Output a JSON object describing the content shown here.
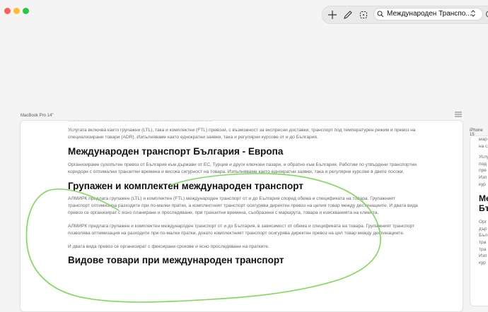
{
  "toolbar": {
    "search_value": "Международен Транспо..."
  },
  "devices": {
    "main_label": "MacBook Pro 14\"",
    "side_label": "iPhone 15"
  },
  "page": {
    "top_text": "................................................................................................................",
    "p1": "Услугата включва както групажни (LTL), така и комплектни (FTL) превози, с възможност за експресни доставки, транспорт под температурен режим и превоз на специализирани товари (ADR). Изпълняваме както еднократни заявки, така и регулярни курсове от и до България.",
    "h1": "Международен транспорт България - Европа",
    "p2": "Организираме сухопътен превоз от България към държави от ЕС, Турция и други ключови пазари, и обратно към България. Работим по утвърдени транспортни коридори с оптимални транзитни времена и висока сигурност на товара. Изпълняваме както еднократни заявки, така и регулярни курсове в двете посоки.",
    "h2": "Групажен и комплектен международен транспорт",
    "p3": "АЛМИРК предлага групажен (LTL) и комплектен (FTL) международен транспорт от и до България според обема и спецификата на товара. Групажният транспорт оптимизира разходите при по-малки пратки, а комплектният транспорт осигурява директен превоз на целия товар между дестинациите. И двата вида превоз се организират с ясно планиране и проследяване, при транзитни времена, съобразени с маршрута, товара и изискванията на клиента.",
    "p4": "АЛМИРК предлага групажен и комплектен международен транспорт от и до България, в зависимост от обема и спецификата на товара. Групажният транспорт позволява оптимизация на разходите при по-малки пратки, докато комплектният транспорт осигурява директен превоз на цял товар между дестинациите.",
    "p5": "И двата вида превоз се организират с фиксирани срокове и ясно проследяване на пратките.",
    "h3": "Видове товари при международен транспорт"
  },
  "side": {
    "t1": "мар",
    "t2": "на с",
    "h1": "Ме",
    "t3": "Услу",
    "t4": "под",
    "t5": "пре",
    "t6": "Изп",
    "t7": "кур",
    "h2": "Ме",
    "h3": "Бъ",
    "t8": "Орг",
    "t9": "дър",
    "t10": "Бъл",
    "t11": "тра",
    "t12": "тра",
    "t13": "Изп",
    "t14": "кур"
  },
  "colors": {
    "annotation_stroke": "#7ed957",
    "heading": "#111111",
    "body_text": "#666666"
  }
}
